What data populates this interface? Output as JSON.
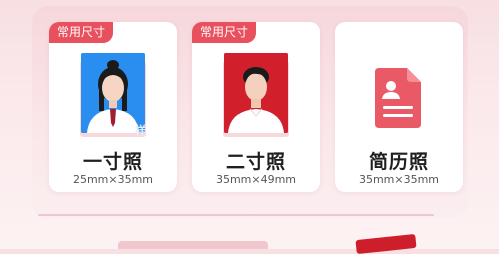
{
  "sizes": [
    {
      "badge": "常用尺寸",
      "title": "一寸照",
      "dimensions": "25mm×35mm",
      "photo_background": "#2a8ef0"
    },
    {
      "badge": "常用尺寸",
      "title": "二寸照",
      "dimensions": "35mm×49mm",
      "photo_background": "#d11f2b"
    },
    {
      "title": "简历照",
      "dimensions": "35mm×35mm",
      "icon": "resume-document-icon"
    }
  ],
  "colors": {
    "accent": "#e8505d",
    "background": "#f7dfe2",
    "card": "#ffffff"
  }
}
